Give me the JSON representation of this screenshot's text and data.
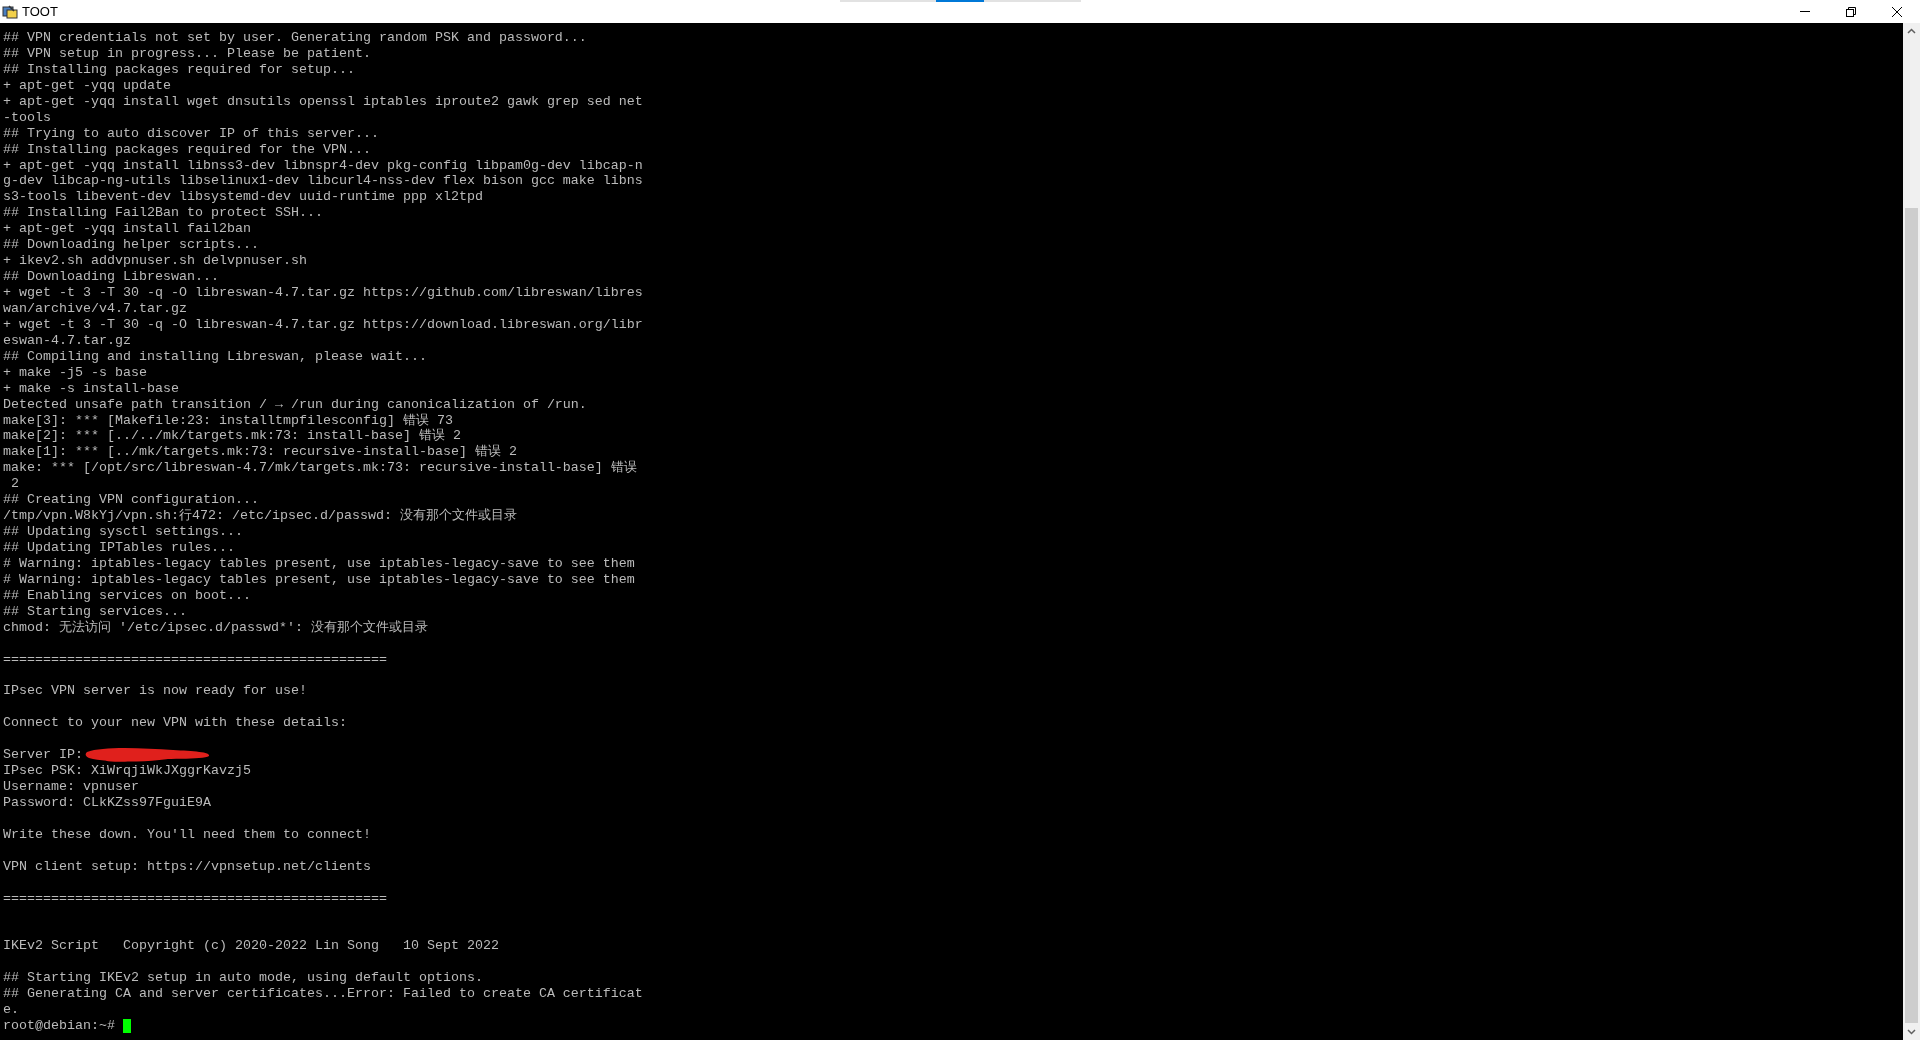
{
  "window": {
    "title": "TOOT"
  },
  "terminal": {
    "lines": [
      {
        "kind": "text",
        "text": "## VPN credentials not set by user. Generating random PSK and password..."
      },
      {
        "kind": "text",
        "text": "## VPN setup in progress... Please be patient."
      },
      {
        "kind": "text",
        "text": "## Installing packages required for setup..."
      },
      {
        "kind": "text",
        "text": "+ apt-get -yqq update"
      },
      {
        "kind": "text",
        "text": "+ apt-get -yqq install wget dnsutils openssl iptables iproute2 gawk grep sed net"
      },
      {
        "kind": "text",
        "text": "-tools"
      },
      {
        "kind": "text",
        "text": "## Trying to auto discover IP of this server..."
      },
      {
        "kind": "text",
        "text": "## Installing packages required for the VPN..."
      },
      {
        "kind": "text",
        "text": "+ apt-get -yqq install libnss3-dev libnspr4-dev pkg-config libpam0g-dev libcap-n"
      },
      {
        "kind": "text",
        "text": "g-dev libcap-ng-utils libselinux1-dev libcurl4-nss-dev flex bison gcc make libns"
      },
      {
        "kind": "text",
        "text": "s3-tools libevent-dev libsystemd-dev uuid-runtime ppp xl2tpd"
      },
      {
        "kind": "text",
        "text": "## Installing Fail2Ban to protect SSH..."
      },
      {
        "kind": "text",
        "text": "+ apt-get -yqq install fail2ban"
      },
      {
        "kind": "text",
        "text": "## Downloading helper scripts..."
      },
      {
        "kind": "text",
        "text": "+ ikev2.sh addvpnuser.sh delvpnuser.sh"
      },
      {
        "kind": "text",
        "text": "## Downloading Libreswan..."
      },
      {
        "kind": "text",
        "text": "+ wget -t 3 -T 30 -q -O libreswan-4.7.tar.gz https://github.com/libreswan/libres"
      },
      {
        "kind": "text",
        "text": "wan/archive/v4.7.tar.gz"
      },
      {
        "kind": "text",
        "text": "+ wget -t 3 -T 30 -q -O libreswan-4.7.tar.gz https://download.libreswan.org/libr"
      },
      {
        "kind": "text",
        "text": "eswan-4.7.tar.gz"
      },
      {
        "kind": "text",
        "text": "## Compiling and installing Libreswan, please wait..."
      },
      {
        "kind": "text",
        "text": "+ make -j5 -s base"
      },
      {
        "kind": "text",
        "text": "+ make -s install-base"
      },
      {
        "kind": "text",
        "text": "Detected unsafe path transition / → /run during canonicalization of /run."
      },
      {
        "kind": "text",
        "text": "make[3]: *** [Makefile:23: installtmpfilesconfig] 错误 73"
      },
      {
        "kind": "text",
        "text": "make[2]: *** [../../mk/targets.mk:73: install-base] 错误 2"
      },
      {
        "kind": "text",
        "text": "make[1]: *** [../mk/targets.mk:73: recursive-install-base] 错误 2"
      },
      {
        "kind": "text",
        "text": "make: *** [/opt/src/libreswan-4.7/mk/targets.mk:73: recursive-install-base] 错误"
      },
      {
        "kind": "text",
        "text": " 2"
      },
      {
        "kind": "text",
        "text": "## Creating VPN configuration..."
      },
      {
        "kind": "text",
        "text": "/tmp/vpn.W8kYj/vpn.sh:行472: /etc/ipsec.d/passwd: 没有那个文件或目录"
      },
      {
        "kind": "text",
        "text": "## Updating sysctl settings..."
      },
      {
        "kind": "text",
        "text": "## Updating IPTables rules..."
      },
      {
        "kind": "text",
        "text": "# Warning: iptables-legacy tables present, use iptables-legacy-save to see them"
      },
      {
        "kind": "text",
        "text": "# Warning: iptables-legacy tables present, use iptables-legacy-save to see them"
      },
      {
        "kind": "text",
        "text": "## Enabling services on boot..."
      },
      {
        "kind": "text",
        "text": "## Starting services..."
      },
      {
        "kind": "text",
        "text": "chmod: 无法访问 '/etc/ipsec.d/passwd*': 没有那个文件或目录"
      },
      {
        "kind": "blank"
      },
      {
        "kind": "text",
        "text": "================================================"
      },
      {
        "kind": "blank"
      },
      {
        "kind": "text",
        "text": "IPsec VPN server is now ready for use!"
      },
      {
        "kind": "blank"
      },
      {
        "kind": "text",
        "text": "Connect to your new VPN with these details:"
      },
      {
        "kind": "blank"
      },
      {
        "kind": "redacted",
        "text": "Server IP:"
      },
      {
        "kind": "text",
        "text": "IPsec PSK: XiWrqjiWkJXggrKavzj5"
      },
      {
        "kind": "text",
        "text": "Username: vpnuser"
      },
      {
        "kind": "text",
        "text": "Password: CLkKZss97FguiE9A"
      },
      {
        "kind": "blank"
      },
      {
        "kind": "text",
        "text": "Write these down. You'll need them to connect!"
      },
      {
        "kind": "blank"
      },
      {
        "kind": "text",
        "text": "VPN client setup: https://vpnsetup.net/clients"
      },
      {
        "kind": "blank"
      },
      {
        "kind": "text",
        "text": "================================================"
      },
      {
        "kind": "blank"
      },
      {
        "kind": "blank"
      },
      {
        "kind": "text",
        "text": "IKEv2 Script   Copyright (c) 2020-2022 Lin Song   10 Sept 2022"
      },
      {
        "kind": "blank"
      },
      {
        "kind": "text",
        "text": "## Starting IKEv2 setup in auto mode, using default options."
      },
      {
        "kind": "text",
        "text": "## Generating CA and server certificates...Error: Failed to create CA certificat"
      },
      {
        "kind": "text",
        "text": "e."
      }
    ],
    "prompt": "root@debian:~#"
  }
}
